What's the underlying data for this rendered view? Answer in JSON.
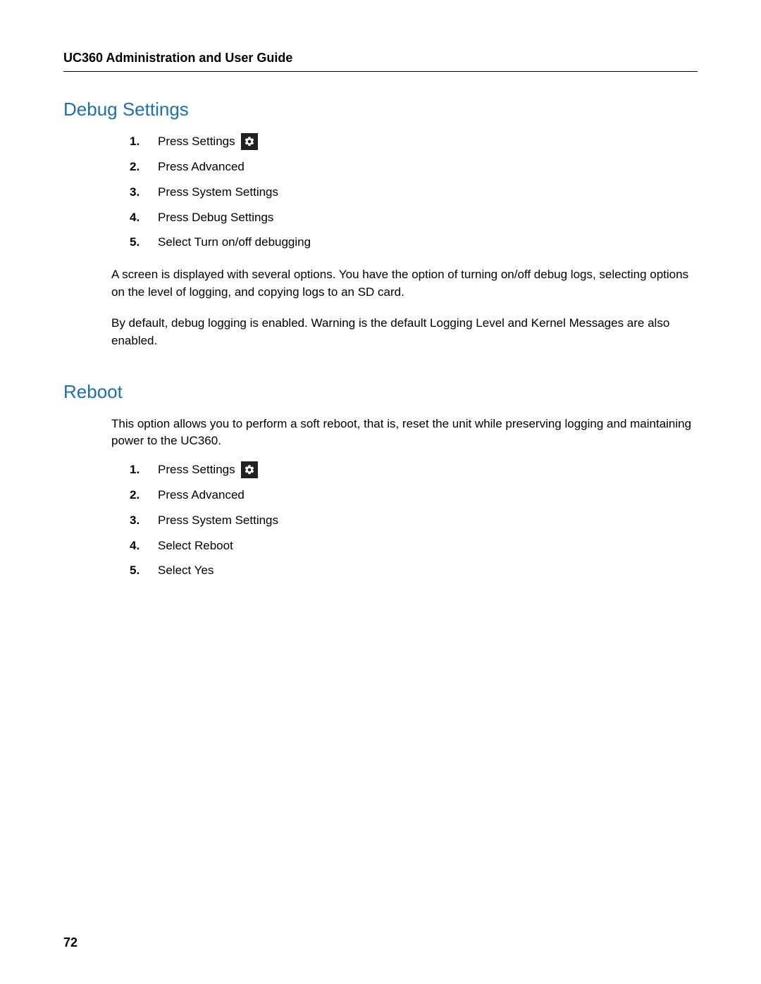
{
  "header": {
    "title": "UC360 Administration and User Guide"
  },
  "sections": {
    "debug": {
      "title": "Debug Settings",
      "steps": [
        {
          "num": "1.",
          "text": "Press Settings",
          "hasIcon": true
        },
        {
          "num": "2.",
          "text": "Press Advanced"
        },
        {
          "num": "3.",
          "text": "Press System Settings"
        },
        {
          "num": "4.",
          "text": "Press Debug Settings"
        },
        {
          "num": "5.",
          "text": "Select Turn on/off debugging"
        }
      ],
      "para1": "A screen is displayed with several options. You have the option of turning on/off debug logs, selecting options on the level of logging, and copying logs to an SD card.",
      "para2": "By default, debug logging is enabled. Warning is the default Logging Level and Kernel Messages are also enabled."
    },
    "reboot": {
      "title": "Reboot",
      "intro": "This option allows you to perform a soft reboot, that is, reset the unit while preserving logging and maintaining power to the UC360.",
      "steps": [
        {
          "num": "1.",
          "text": "Press Settings",
          "hasIcon": true
        },
        {
          "num": "2.",
          "text": "Press Advanced"
        },
        {
          "num": "3.",
          "text": "Press System Settings"
        },
        {
          "num": "4.",
          "text": "Select Reboot"
        },
        {
          "num": "5.",
          "text": "Select Yes"
        }
      ]
    }
  },
  "pageNumber": "72",
  "iconLabel": "Settings"
}
